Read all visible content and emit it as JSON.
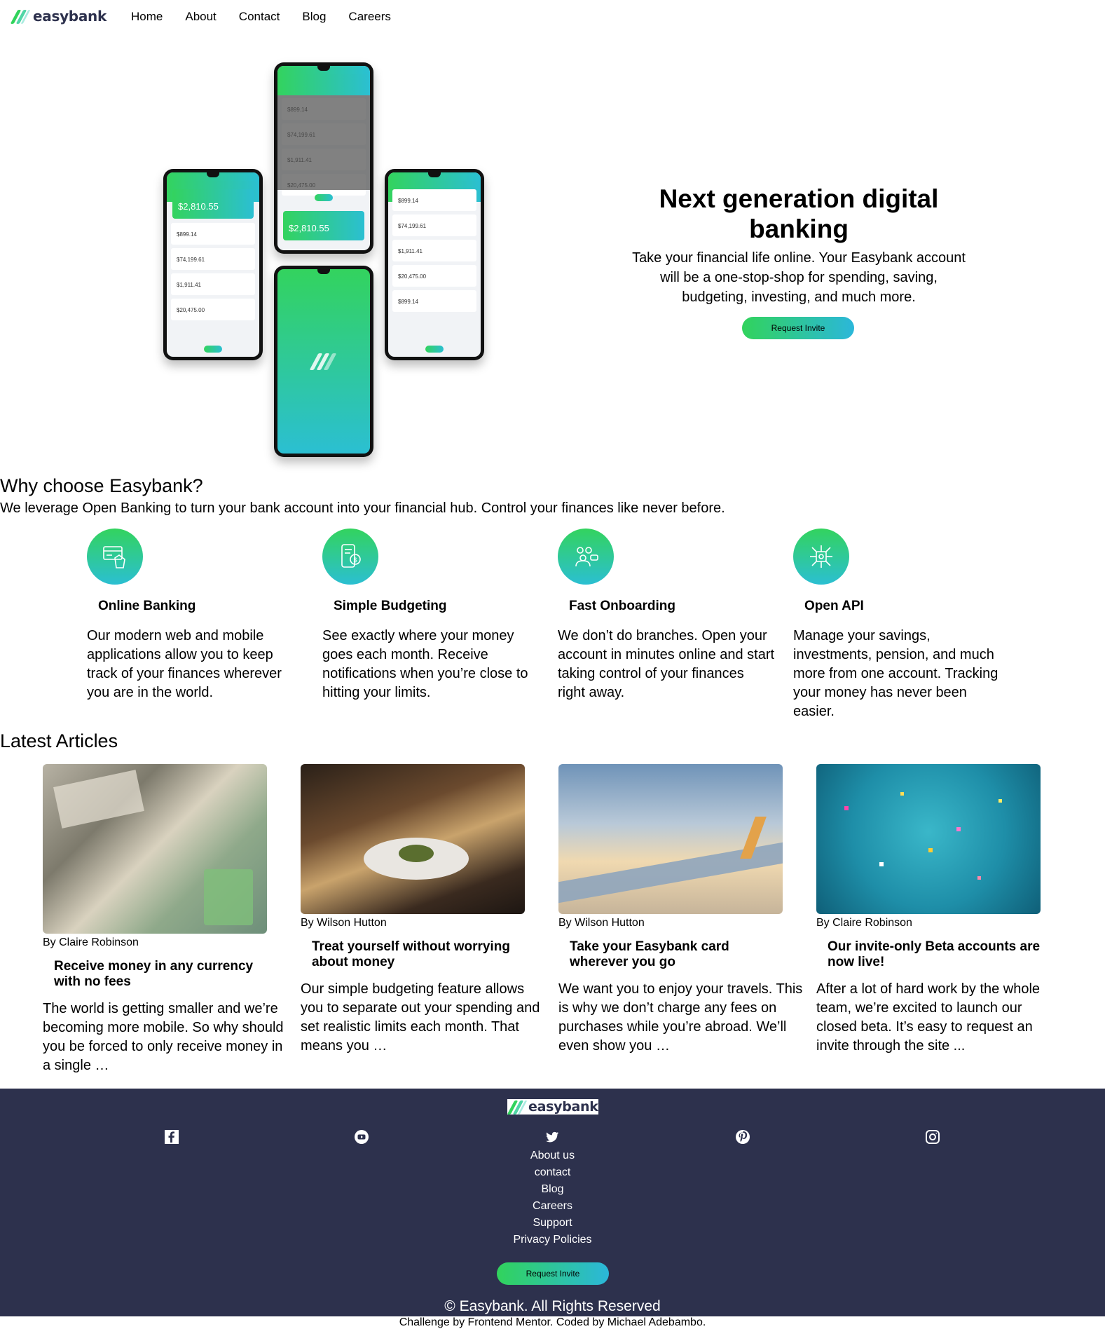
{
  "brand": {
    "name": "easybank"
  },
  "nav": {
    "links": [
      "Home",
      "About",
      "Contact",
      "Blog",
      "Careers"
    ]
  },
  "hero": {
    "title": "Next generation digital banking",
    "description": "Take your financial life online. Your Easybank account will be a one-stop-shop for spending, saving, budgeting, investing, and much more.",
    "cta": "Request Invite",
    "phone_balances": [
      "$2,810.55",
      "$899.14",
      "$74,199.61",
      "$1,911.41",
      "$20,475.00"
    ]
  },
  "why": {
    "title": "Why choose Easybank?",
    "description": "We leverage Open Banking to turn your bank account into your financial hub. Control your finances like never before.",
    "features": [
      {
        "title": "Online Banking",
        "icon": "online-banking-icon",
        "text": "Our modern web and mobile applications allow you to keep track of your finances wherever you are in the world."
      },
      {
        "title": "Simple Budgeting",
        "icon": "budgeting-icon",
        "text": "See exactly where your money goes each month. Receive notifications when you’re close to hitting your limits."
      },
      {
        "title": "Fast Onboarding",
        "icon": "onboarding-icon",
        "text": "We don’t do branches. Open your account in minutes online and start taking control of your finances right away."
      },
      {
        "title": "Open API",
        "icon": "api-icon",
        "text": "Manage your savings, investments, pension, and much more from one account. Tracking your money has never been easier."
      }
    ]
  },
  "articles": {
    "title": "Latest Articles",
    "items": [
      {
        "author": "By Claire Robinson",
        "title": "Receive money in any currency with no fees",
        "text": "The world is getting smaller and we’re becoming more mobile. So why should you be forced to only receive money in a single …"
      },
      {
        "author": "By Wilson Hutton",
        "title": "Treat yourself without worrying about money",
        "text": "Our simple budgeting feature allows you to separate out your spending and set realistic limits each month. That means you …"
      },
      {
        "author": "By Wilson Hutton",
        "title": "Take your Easybank card wherever you go",
        "text": "We want you to enjoy your travels. This is why we don’t charge any fees on purchases while you’re abroad. We’ll even show you …"
      },
      {
        "author": "By Claire Robinson",
        "title": "Our invite-only Beta accounts are now live!",
        "text": "After a lot of hard work by the whole team, we’re excited to launch our closed beta. It’s easy to request an invite through the site ..."
      }
    ]
  },
  "footer": {
    "social": [
      "facebook-icon",
      "youtube-icon",
      "twitter-icon",
      "pinterest-icon",
      "instagram-icon"
    ],
    "links": [
      "About us",
      "contact",
      "Blog",
      "Careers",
      "Support",
      "Privacy Policies"
    ],
    "cta": "Request Invite",
    "copyright": "© Easybank. All Rights Reserved",
    "credit": "Challenge by Frontend Mentor. Coded by Michael Adebambo."
  },
  "colors": {
    "navy": "#2d314d",
    "green": "#31d35c",
    "cyan": "#2bb7da"
  }
}
